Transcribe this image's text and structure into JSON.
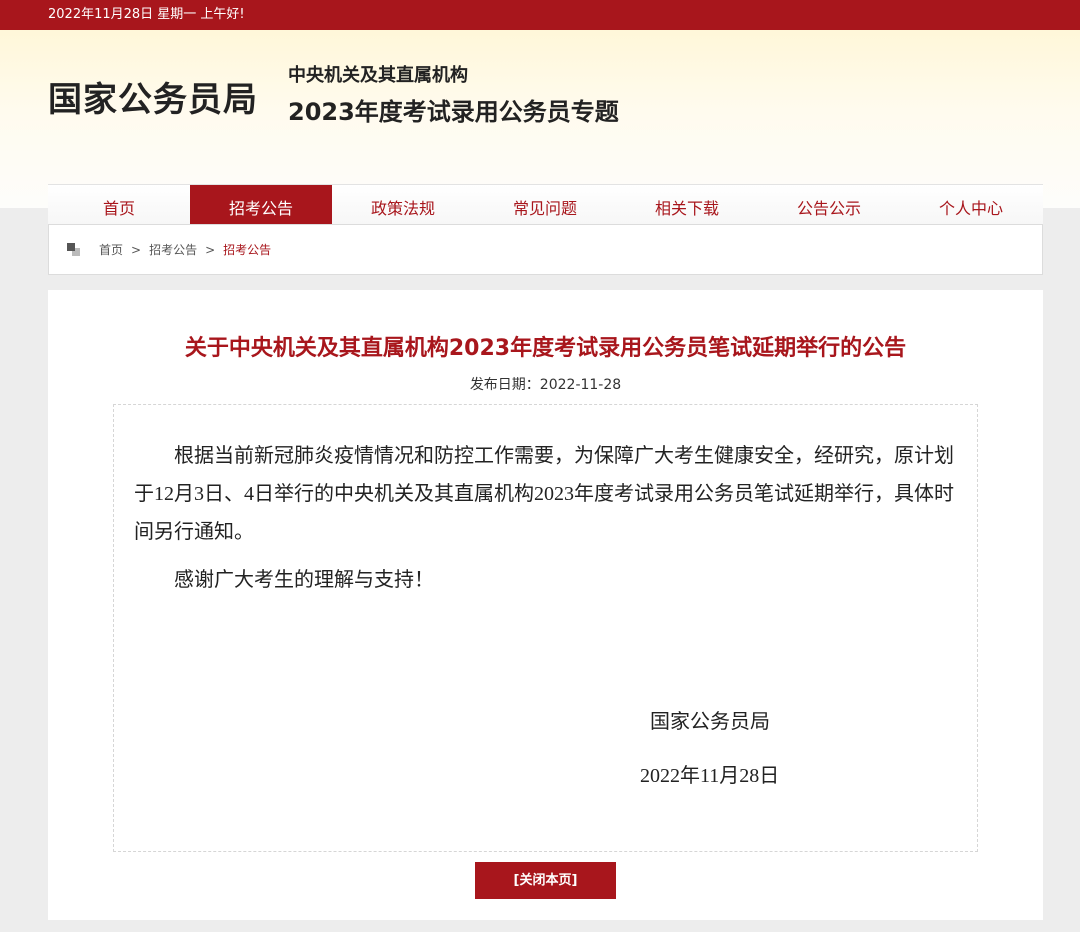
{
  "topbar": {
    "greeting": "2022年11月28日  星期一  上午好!"
  },
  "header": {
    "site_name": "国家公务员局",
    "subtitle_line1": "中央机关及其直属机构",
    "subtitle_line2": "2023年度考试录用公务员专题"
  },
  "nav": {
    "items": [
      {
        "label": "首页"
      },
      {
        "label": "招考公告"
      },
      {
        "label": "政策法规"
      },
      {
        "label": "常见问题"
      },
      {
        "label": "相关下载"
      },
      {
        "label": "公告公示"
      },
      {
        "label": "个人中心"
      }
    ],
    "active_index": 1,
    "accent_color": "#a8161c"
  },
  "breadcrumb": {
    "icon": "home-squares-icon",
    "items": [
      "首页",
      "招考公告",
      "招考公告"
    ],
    "separator": ">"
  },
  "article": {
    "title": "关于中央机关及其直属机构2023年度考试录用公务员笔试延期举行的公告",
    "pub_date_label": "发布日期：2022-11-28",
    "paragraphs": [
      "根据当前新冠肺炎疫情情况和防控工作需要，为保障广大考生健康安全，经研究，原计划于12月3日、4日举行的中央机关及其直属机构2023年度考试录用公务员笔试延期举行，具体时间另行通知。",
      "感谢广大考生的理解与支持！"
    ],
    "signature_org": "国家公务员局",
    "signature_date": "2022年11月28日"
  },
  "close_button": {
    "label": "[关闭本页]"
  }
}
